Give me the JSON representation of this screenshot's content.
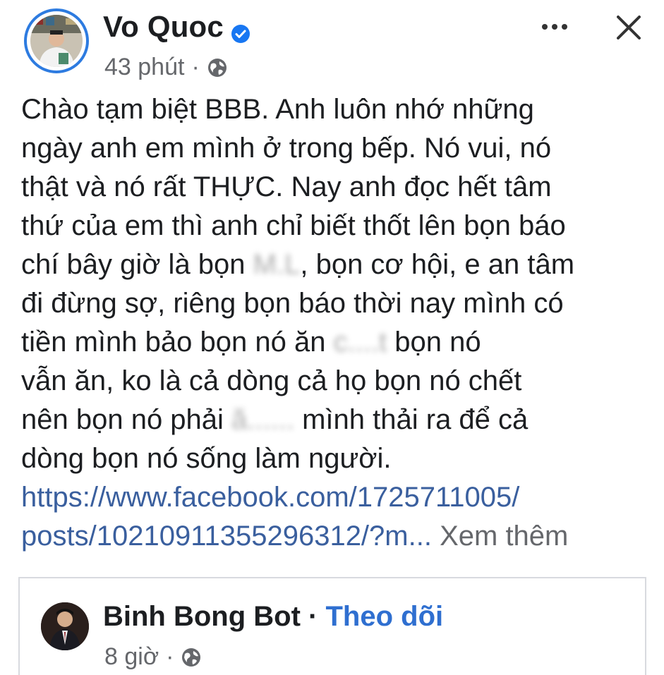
{
  "post": {
    "author": "Vo Quoc",
    "time": "43 phút",
    "separator": "·",
    "lines": [
      "Chào tạm biệt BBB. Anh luôn nhớ những",
      "ngày anh em mình ở trong bếp. Nó vui, nó",
      "thật và nó rất THỰC. Nay anh đọc hết tâm",
      "thứ của em thì anh chỉ biết thốt lên bọn báo"
    ],
    "line5_pre": "chí bây giờ là bọn ",
    "line5_blur": "M.L",
    "line5_post": ", bọn cơ hội, e an tâm",
    "line6": "đi đừng sợ, riêng bọn báo thời nay mình có",
    "line7_pre": "tiền mình bảo bọn nó ăn ",
    "line7_blur": "c....t",
    "line7_post": " bọn nó",
    "line8": "vẫn ăn, ko là cả dòng cả họ bọn nó chết",
    "line9_pre": "nên bọn nó phải ",
    "line9_blur": "ă......",
    "line9_post": " mình thải ra  để cả",
    "line10": "dòng bọn nó sống làm người.",
    "link_line1": "https://www.facebook.com/1725711005/",
    "link_line2": "posts/10210911355296312/?m...",
    "see_more": "Xem thêm"
  },
  "shared": {
    "author": "Binh Bong Bot",
    "dot": "·",
    "follow": "Theo dõi",
    "time": "8 giờ",
    "separator": "·"
  },
  "colors": {
    "link": "#3a5f9e",
    "follow": "#2f6fd0",
    "verified": "#1877f2",
    "meta": "#65676b"
  },
  "icons": {
    "verified": "verified-badge-icon",
    "globe": "globe-icon",
    "more": "more-options-icon",
    "close": "close-icon"
  }
}
